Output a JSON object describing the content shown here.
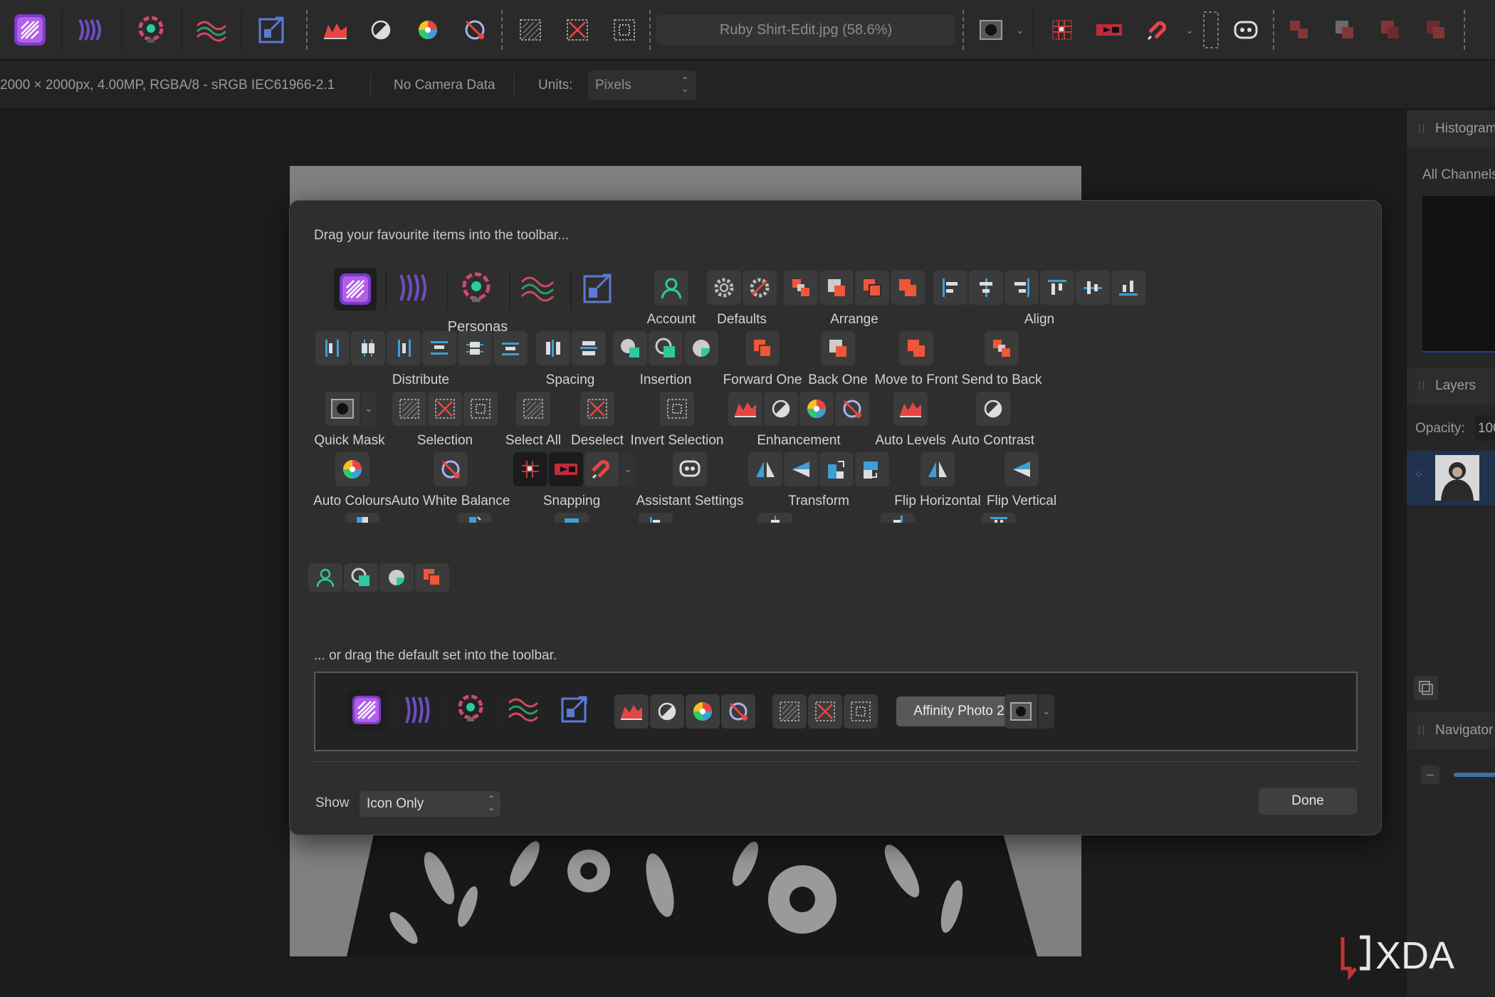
{
  "window": {
    "document_title": "Ruby Shirt-Edit.jpg (58.6%)"
  },
  "context_bar": {
    "doc_info": "2000 × 2000px, 4.00MP, RGBA/8 - sRGB IEC61966-2.1",
    "camera": "No Camera Data",
    "units_label": "Units:",
    "units_value": "Pixels"
  },
  "panels": {
    "histogram_title": "Histogram",
    "histogram_channel": "All Channels",
    "layers_title": "Layers",
    "opacity_label": "Opacity:",
    "opacity_value": "100",
    "navigator_title": "Navigator"
  },
  "dialog": {
    "drag_hint": "Drag your favourite items into the toolbar...",
    "default_hint": "... or drag the default set into the toolbar.",
    "show_label": "Show",
    "show_value": "Icon Only",
    "done_label": "Done",
    "default_set_name": "Affinity Photo 2",
    "groups": {
      "personas": "Personas",
      "account": "Account",
      "defaults": "Defaults",
      "arrange": "Arrange",
      "align": "Align",
      "distribute": "Distribute",
      "spacing": "Spacing",
      "insertion": "Insertion",
      "forward_one": "Forward One",
      "back_one": "Back One",
      "move_to_front": "Move to Front",
      "send_to_back": "Send to Back",
      "quick_mask": "Quick Mask",
      "selection": "Selection",
      "select_all": "Select All",
      "deselect": "Deselect",
      "invert_selection": "Invert Selection",
      "enhancement": "Enhancement",
      "auto_levels": "Auto Levels",
      "auto_contrast": "Auto Contrast",
      "auto_colours": "Auto Colours",
      "auto_white_balance": "Auto White Balance",
      "snapping": "Snapping",
      "assistant_settings": "Assistant Settings",
      "transform": "Transform",
      "flip_horizontal": "Flip Horizontal",
      "flip_vertical": "Flip Vertical"
    }
  },
  "watermark": "XDA",
  "colors": {
    "accent_orange": "#f0563a",
    "accent_blue": "#3d9fd6",
    "accent_green": "#2ec9a0",
    "persona_purple": "#8e3fd8"
  }
}
